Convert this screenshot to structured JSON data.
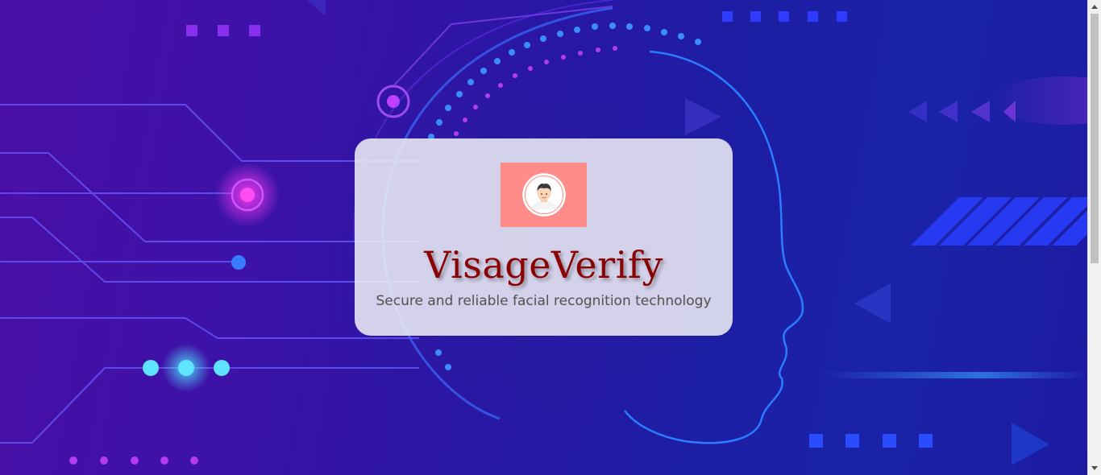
{
  "brand": {
    "title": "VisageVerify",
    "tagline": "Secure and reliable facial recognition technology"
  },
  "logo": {
    "icon": "user-avatar-icon",
    "background": "#ff8c89"
  },
  "colors": {
    "title": "#8b0000",
    "tagline": "#555555",
    "card_background": "#ececf4"
  }
}
